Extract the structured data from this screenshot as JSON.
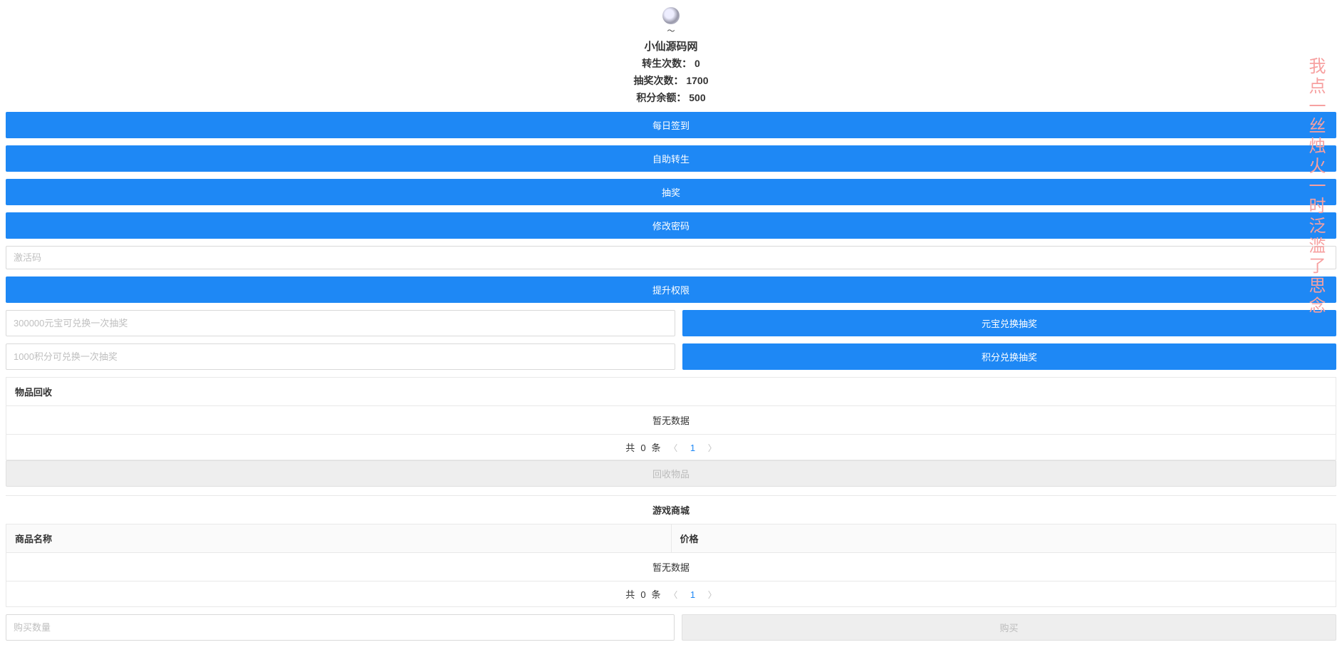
{
  "header": {
    "site_title": "小仙源码网",
    "rebirth_label": "转生次数：",
    "rebirth_value": "0",
    "lottery_label": "抽奖次数：",
    "lottery_value": "1700",
    "points_label": "积分余额：",
    "points_value": "500"
  },
  "buttons": {
    "daily_sign": "每日签到",
    "self_rebirth": "自助转生",
    "lottery": "抽奖",
    "change_password": "修改密码",
    "upgrade_permission": "提升权限",
    "yuanbao_exchange": "元宝兑换抽奖",
    "points_exchange": "积分兑换抽奖",
    "recycle_items": "回收物品",
    "buy": "购买"
  },
  "inputs": {
    "activation_code_placeholder": "激活码",
    "yuanbao_placeholder": "300000元宝可兑换一次抽奖",
    "points_placeholder": "1000积分可兑换一次抽奖",
    "buy_qty_placeholder": "购买数量"
  },
  "recycle": {
    "title": "物品回收",
    "empty": "暂无数据",
    "total_prefix": "共",
    "total_count": "0",
    "total_suffix": "条",
    "page": "1"
  },
  "mall": {
    "title": "游戏商城",
    "col_name": "商品名称",
    "col_price": "价格",
    "empty": "暂无数据",
    "total_prefix": "共",
    "total_count": "0",
    "total_suffix": "条",
    "page": "1"
  },
  "side_text": "我点一丝烛火一时泛滥了思念"
}
